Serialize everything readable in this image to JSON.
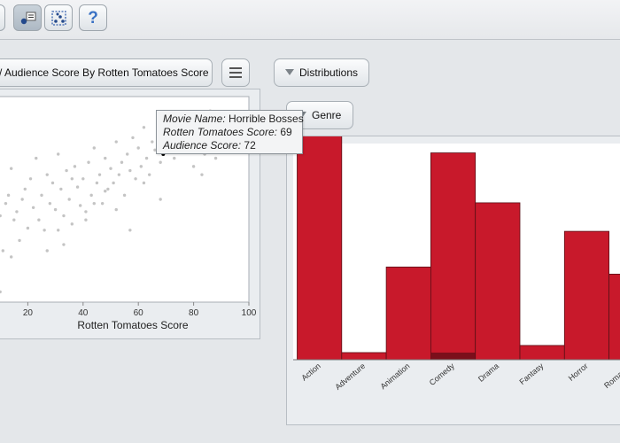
{
  "toolbar": {
    "buttons": [
      {
        "name": "partial-button",
        "icon": "unknown-icon"
      },
      {
        "name": "annotate-button",
        "icon": "node-list-icon",
        "active": true
      },
      {
        "name": "select-button",
        "icon": "box-select-icon"
      },
      {
        "name": "help-button",
        "icon": "question-icon",
        "label": "?"
      }
    ]
  },
  "scatter": {
    "title_label": "/ Audience Score By Rotten Tomatoes Score",
    "x_axis_label": "Rotten Tomatoes Score",
    "x_ticks": [
      "20",
      "40",
      "60",
      "80",
      "100"
    ]
  },
  "tooltip": {
    "movie_label": "Movie Name:",
    "movie_value": "Horrible Bosses",
    "rt_label": "Rotten Tomatoes Score:",
    "rt_value": "69",
    "aud_label": "Audience Score:",
    "aud_value": "72"
  },
  "distributions": {
    "dropdown_label": "Distributions",
    "field_label": "Genre"
  },
  "colors": {
    "bar": "#c8192b",
    "bar_highlight": "#7b0f1b",
    "point": "#c4c4c4",
    "point_selected": "#000000"
  },
  "chart_data": [
    {
      "type": "scatter",
      "xlabel": "Rotten Tomatoes Score",
      "ylabel": "",
      "xlim": [
        0,
        100
      ],
      "ylim": [
        0,
        100
      ],
      "x_ticks": [
        20,
        40,
        60,
        80,
        100
      ],
      "grid": false,
      "points": [
        [
          2,
          15
        ],
        [
          2,
          45
        ],
        [
          3,
          60
        ],
        [
          4,
          30
        ],
        [
          5,
          35
        ],
        [
          6,
          50
        ],
        [
          6,
          68
        ],
        [
          8,
          38
        ],
        [
          9,
          58
        ],
        [
          10,
          42
        ],
        [
          11,
          25
        ],
        [
          12,
          48
        ],
        [
          13,
          52
        ],
        [
          14,
          65
        ],
        [
          15,
          40
        ],
        [
          16,
          44
        ],
        [
          17,
          30
        ],
        [
          18,
          50
        ],
        [
          19,
          55
        ],
        [
          20,
          36
        ],
        [
          21,
          60
        ],
        [
          22,
          46
        ],
        [
          23,
          70
        ],
        [
          24,
          40
        ],
        [
          25,
          52
        ],
        [
          26,
          35
        ],
        [
          27,
          62
        ],
        [
          28,
          48
        ],
        [
          29,
          58
        ],
        [
          30,
          45
        ],
        [
          31,
          72
        ],
        [
          32,
          55
        ],
        [
          33,
          42
        ],
        [
          34,
          64
        ],
        [
          35,
          50
        ],
        [
          36,
          38
        ],
        [
          37,
          66
        ],
        [
          38,
          56
        ],
        [
          39,
          47
        ],
        [
          40,
          60
        ],
        [
          41,
          44
        ],
        [
          42,
          68
        ],
        [
          43,
          52
        ],
        [
          44,
          75
        ],
        [
          45,
          58
        ],
        [
          46,
          62
        ],
        [
          47,
          48
        ],
        [
          48,
          70
        ],
        [
          49,
          55
        ],
        [
          50,
          65
        ],
        [
          51,
          58
        ],
        [
          52,
          78
        ],
        [
          53,
          62
        ],
        [
          54,
          68
        ],
        [
          55,
          52
        ],
        [
          56,
          72
        ],
        [
          57,
          64
        ],
        [
          58,
          80
        ],
        [
          59,
          60
        ],
        [
          60,
          75
        ],
        [
          61,
          66
        ],
        [
          62,
          85
        ],
        [
          63,
          70
        ],
        [
          64,
          62
        ],
        [
          65,
          78
        ],
        [
          66,
          74
        ],
        [
          67,
          86
        ],
        [
          68,
          68
        ],
        [
          70,
          82
        ],
        [
          71,
          76
        ],
        [
          72,
          88
        ],
        [
          73,
          70
        ],
        [
          74,
          80
        ],
        [
          75,
          90
        ],
        [
          76,
          74
        ],
        [
          78,
          84
        ],
        [
          79,
          92
        ],
        [
          80,
          66
        ],
        [
          81,
          78
        ],
        [
          82,
          88
        ],
        [
          84,
          72
        ],
        [
          85,
          86
        ],
        [
          86,
          93
        ],
        [
          87,
          80
        ],
        [
          88,
          70
        ],
        [
          90,
          88
        ],
        [
          92,
          82
        ],
        [
          94,
          90
        ],
        [
          96,
          86
        ],
        [
          98,
          92
        ],
        [
          31,
          35
        ],
        [
          33,
          28
        ],
        [
          36,
          60
        ],
        [
          41,
          40
        ],
        [
          52,
          45
        ],
        [
          57,
          35
        ],
        [
          62,
          58
        ],
        [
          68,
          50
        ],
        [
          83,
          62
        ],
        [
          14,
          22
        ],
        [
          10,
          5
        ],
        [
          4,
          10
        ],
        [
          27,
          25
        ],
        [
          44,
          48
        ],
        [
          48,
          54
        ]
      ],
      "selected_point": {
        "x": 69,
        "y": 72,
        "label": "Horrible Bosses"
      }
    },
    {
      "type": "bar",
      "xlabel": "Genre",
      "ylabel": "",
      "categories": [
        "Action",
        "Adventure",
        "Animation",
        "Comedy",
        "Drama",
        "Fantasy",
        "Horror",
        "Romance"
      ],
      "values": [
        34,
        1,
        13,
        29,
        22,
        2,
        18,
        12
      ],
      "highlighted": [
        0,
        0,
        0,
        1,
        0,
        0,
        0,
        0
      ],
      "ylim": [
        0,
        36
      ]
    }
  ]
}
